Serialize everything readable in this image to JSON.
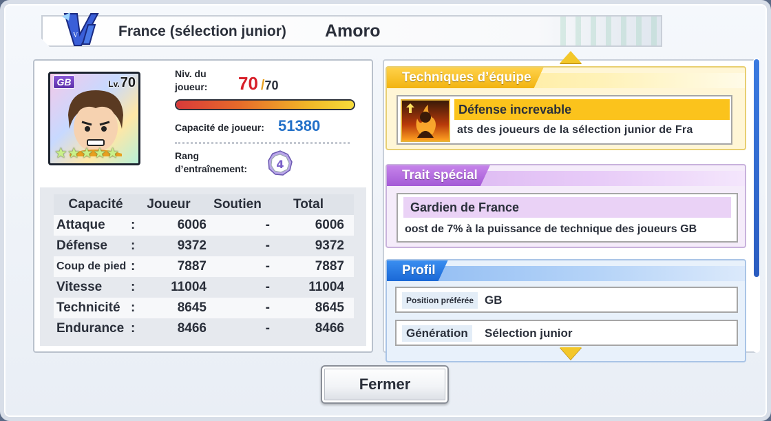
{
  "header": {
    "team": "France (sélection junior)",
    "player_name": "Amoro"
  },
  "card": {
    "position_badge": "GB",
    "lv_prefix": "Lv.",
    "level": "70",
    "stars": "★★★★★",
    "star_count": 5
  },
  "player_level": {
    "label": "Niv. du joueur:",
    "current": "70",
    "separator": "/",
    "max": "70",
    "progress_fraction": 1.0
  },
  "capacity": {
    "label": "Capacité de joueur:",
    "value": "51380"
  },
  "training_rank": {
    "label": "Rang d’entraînement:",
    "value": "4"
  },
  "stats": {
    "headers": [
      "Capacité",
      "Joueur",
      "Soutien",
      "Total"
    ],
    "rows": [
      {
        "name": "Attaque",
        "colon": ":",
        "joueur": "6006",
        "soutien": "-",
        "total": "6006"
      },
      {
        "name": "Défense",
        "colon": ":",
        "joueur": "9372",
        "soutien": "-",
        "total": "9372"
      },
      {
        "name": "Coup de pied",
        "colon": ":",
        "joueur": "7887",
        "soutien": "-",
        "total": "7887"
      },
      {
        "name": "Vitesse",
        "colon": ":",
        "joueur": "11004",
        "soutien": "-",
        "total": "11004"
      },
      {
        "name": "Technicité",
        "colon": ":",
        "joueur": "8645",
        "soutien": "-",
        "total": "8645"
      },
      {
        "name": "Endurance",
        "colon": ":",
        "joueur": "8466",
        "soutien": "-",
        "total": "8466"
      }
    ]
  },
  "team_technique": {
    "title": "Techniques d’équipe",
    "name": "Défense increvable",
    "description": "ats des joueurs de la sélection junior de Fra"
  },
  "special_trait": {
    "title": "Trait spécial",
    "name": "Gardien de France",
    "description": "oost de 7% à la puissance de technique des joueurs GB"
  },
  "profile": {
    "title": "Profil",
    "rows": [
      {
        "key": "Position préférée",
        "value": "GB"
      },
      {
        "key": "Génération",
        "value": "Sélection junior"
      }
    ]
  },
  "close_button": "Fermer",
  "logo_text": "V",
  "colors": {
    "level_current": "#d7202a",
    "capacity_value": "#2270c8",
    "technique_accent": "#f2b410",
    "trait_accent": "#a45ad6",
    "profile_accent": "#1a68d6",
    "scroll_arrow": "#f3c72a"
  }
}
